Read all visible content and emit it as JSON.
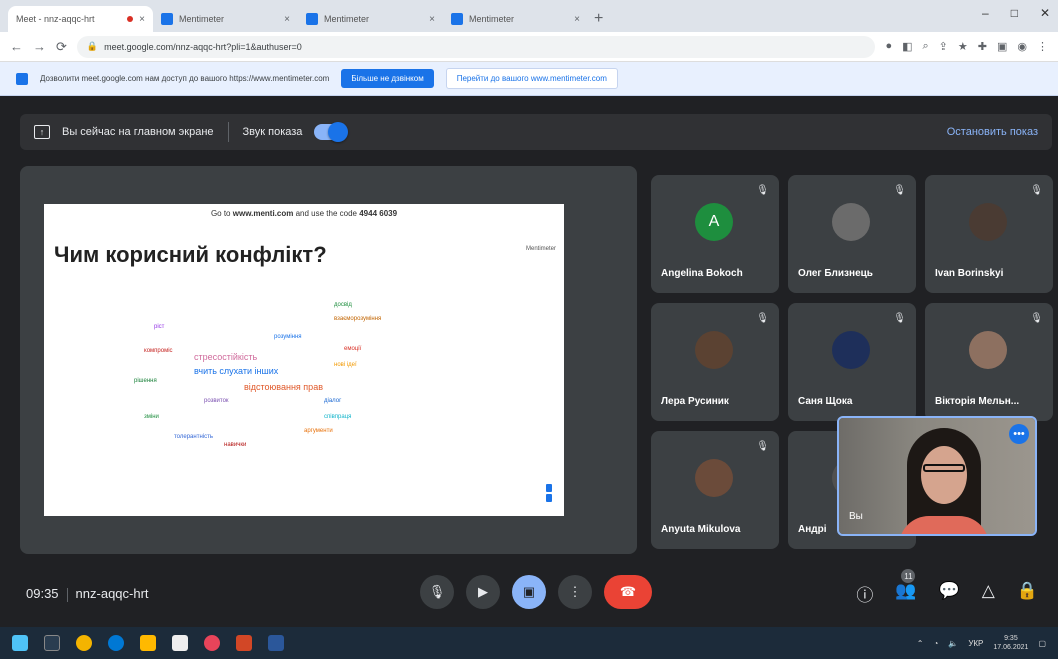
{
  "browser": {
    "tabs": [
      {
        "label": "Meet - nnz-aqqc-hrt",
        "active": true
      },
      {
        "label": "Mentimeter"
      },
      {
        "label": "Mentimeter"
      },
      {
        "label": "Mentimeter"
      }
    ],
    "url": "meet.google.com/nnz-aqqc-hrt?pli=1&authuser=0",
    "infobar_text": "Дозволити meet.google.com нам доступ до вашого https://www.mentimeter.com",
    "infobar_button": "Більше не дзвінком",
    "infobar_link": "Перейти до вашого www.mentimeter.com"
  },
  "sharebar": {
    "status": "Вы сейчас на главном экране",
    "sound_label": "Звук показа",
    "stop_label": "Остановить показ"
  },
  "slide": {
    "code_prefix": "Go to",
    "code_site": "www.menti.com",
    "code_middle": "and use the code",
    "code_value": "4944 6039",
    "question": "Чим корисний конфлікт?",
    "logo": "Mentimeter",
    "words": [
      {
        "t": "вчить слухати інших",
        "c": "#1a73e8",
        "s": 9
      },
      {
        "t": "стресостійкість",
        "c": "#d06b9c",
        "s": 9
      },
      {
        "t": "відстоювання прав",
        "c": "#e0592a",
        "s": 9
      },
      {
        "t": "розвиток",
        "c": "#7a4fb0",
        "s": 6
      },
      {
        "t": "досвід",
        "c": "#1e8e3e",
        "s": 6
      },
      {
        "t": "компроміс",
        "c": "#c5221f",
        "s": 6
      },
      {
        "t": "нові ідеї",
        "c": "#f29900",
        "s": 6
      },
      {
        "t": "розуміння",
        "c": "#1a73e8",
        "s": 6
      },
      {
        "t": "емоції",
        "c": "#d93025",
        "s": 6
      },
      {
        "t": "співпраця",
        "c": "#12b5cb",
        "s": 6
      },
      {
        "t": "рішення",
        "c": "#188038",
        "s": 6
      },
      {
        "t": "ріст",
        "c": "#9334e6",
        "s": 6
      },
      {
        "t": "аргументи",
        "c": "#e8710a",
        "s": 6
      },
      {
        "t": "діалог",
        "c": "#1967d2",
        "s": 6
      },
      {
        "t": "навички",
        "c": "#b31412",
        "s": 6
      },
      {
        "t": "зміни",
        "c": "#1e8e3e",
        "s": 6
      },
      {
        "t": "взаєморозуміння",
        "c": "#c26401",
        "s": 6
      },
      {
        "t": "толерантність",
        "c": "#3367d6",
        "s": 6
      }
    ]
  },
  "participants": [
    {
      "name": "Angelina Bokoch",
      "initial": "A",
      "color": "#1e8e3e"
    },
    {
      "name": "Олег Близнець",
      "initial": "",
      "color": "#6b6b6b"
    },
    {
      "name": "Ivan Borinskyi",
      "initial": "",
      "color": "#4a3b33"
    },
    {
      "name": "Лера Русиник",
      "initial": "",
      "color": "#5b4232"
    },
    {
      "name": "Саня Щока",
      "initial": "",
      "color": "#1e2f5a"
    },
    {
      "name": "Вікторія Мельн...",
      "initial": "",
      "color": "#8d7060"
    },
    {
      "name": "Anyuta Mikulova",
      "initial": "",
      "color": "#6b4b3a"
    },
    {
      "name": "Андрі",
      "initial": "",
      "color": "#505050"
    }
  ],
  "selfview": {
    "label": "Вы",
    "more": "•••"
  },
  "meeting": {
    "time": "09:35",
    "code": "nnz-aqqc-hrt",
    "participants_count": "11"
  },
  "taskbar": {
    "time": "9:35",
    "date": "17.06.2021",
    "lang": "УКР"
  }
}
